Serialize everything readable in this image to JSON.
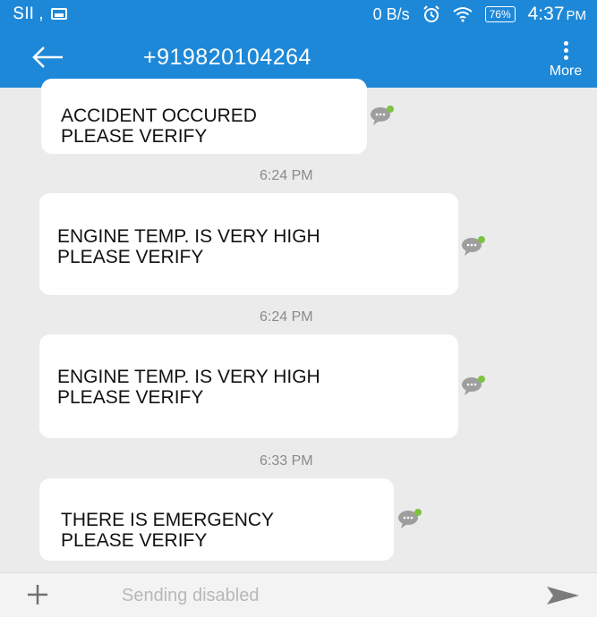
{
  "status_bar": {
    "signal_text": "ՏII ,",
    "network_speed": "0 B/s",
    "battery_percent": "76%",
    "time": "4:37",
    "ampm": "PM"
  },
  "header": {
    "title": "+919820104264",
    "more_label": "More"
  },
  "messages": [
    {
      "lines": [
        "ACCIDENT OCCURED",
        "PLEASE VERIFY"
      ]
    },
    {
      "time": "6:24 PM"
    },
    {
      "lines": [
        "ENGINE TEMP. IS VERY HIGH",
        "PLEASE VERIFY"
      ]
    },
    {
      "time": "6:24 PM"
    },
    {
      "lines": [
        "ENGINE TEMP. IS VERY HIGH",
        "PLEASE VERIFY"
      ]
    },
    {
      "time": "6:33 PM"
    },
    {
      "lines": [
        "THERE IS EMERGENCY",
        "PLEASE VERIFY"
      ]
    }
  ],
  "composer": {
    "placeholder": "Sending disabled"
  },
  "colors": {
    "accent": "#1e88d8",
    "chat_icon": "#9e9e9e",
    "chat_icon_badge": "#7cc243"
  }
}
